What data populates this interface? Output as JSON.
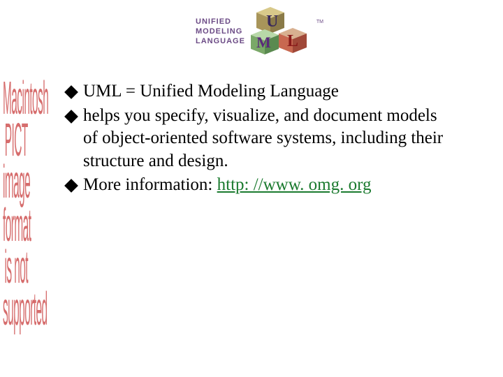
{
  "logo": {
    "line1": "UNIFIED",
    "line2": "MODELING",
    "line3": "LANGUAGE",
    "tm": "TM"
  },
  "bullets": [
    {
      "lead": "UML",
      "rest": " = Unified Modeling Language"
    },
    {
      "lead": "helps",
      "rest": " you specify, visualize, and document models of object-oriented software systems, including their structure and design."
    },
    {
      "lead": "More",
      "rest": " information: ",
      "link_text": "http: //www. omg. org",
      "link_href": "http://www.omg.org"
    }
  ],
  "placeholder": {
    "l1": "Macintosh PICT",
    "l2": "image format",
    "l3": "is not supported"
  }
}
